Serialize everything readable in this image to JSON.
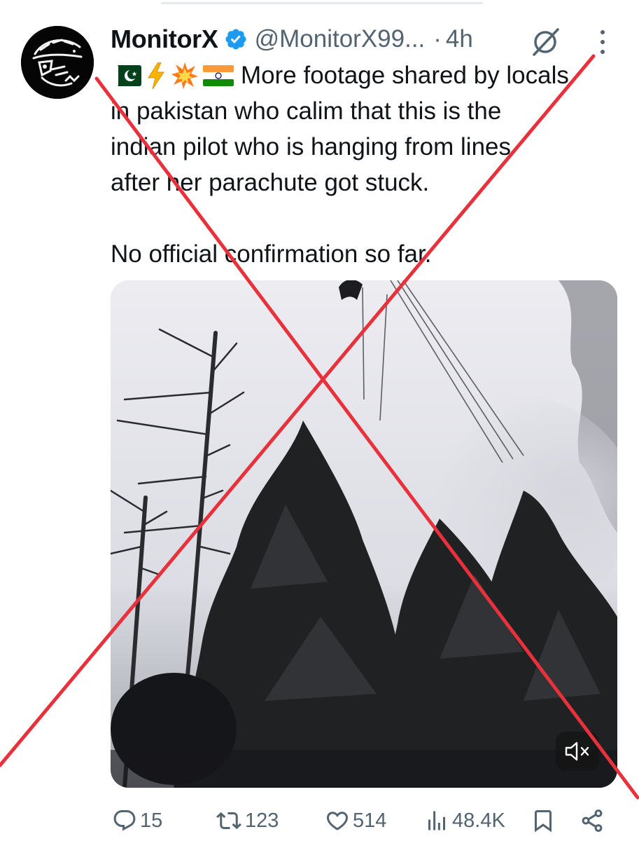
{
  "post": {
    "author_name": "MonitorX",
    "handle": "@MonitorX99...",
    "separator": "·",
    "time": "4h",
    "text_line1": "More footage shared by locals",
    "text_line2": "in pakistan who calim that this is the",
    "text_line3": "indian pilot who is hanging from lines",
    "text_line4": "after her parachute got stuck.",
    "text_line5": "No official confirmation so far.",
    "flags": [
      "pakistan-flag",
      "lightning-emoji",
      "collision-emoji",
      "india-flag"
    ]
  },
  "media": {
    "type": "video",
    "muted": true,
    "icons": [
      "mute-icon"
    ]
  },
  "actions": {
    "replies": "15",
    "reposts": "123",
    "likes": "514",
    "views": "48.4K",
    "icons": [
      "reply-icon",
      "repost-icon",
      "like-icon",
      "views-icon",
      "bookmark-icon",
      "share-icon"
    ]
  },
  "overlay": {
    "type": "red-cross",
    "color": "#e8313b"
  },
  "colors": {
    "text": "#0f1419",
    "muted": "#536471",
    "verified": "#1d9bf0",
    "cross": "#e8313b"
  }
}
